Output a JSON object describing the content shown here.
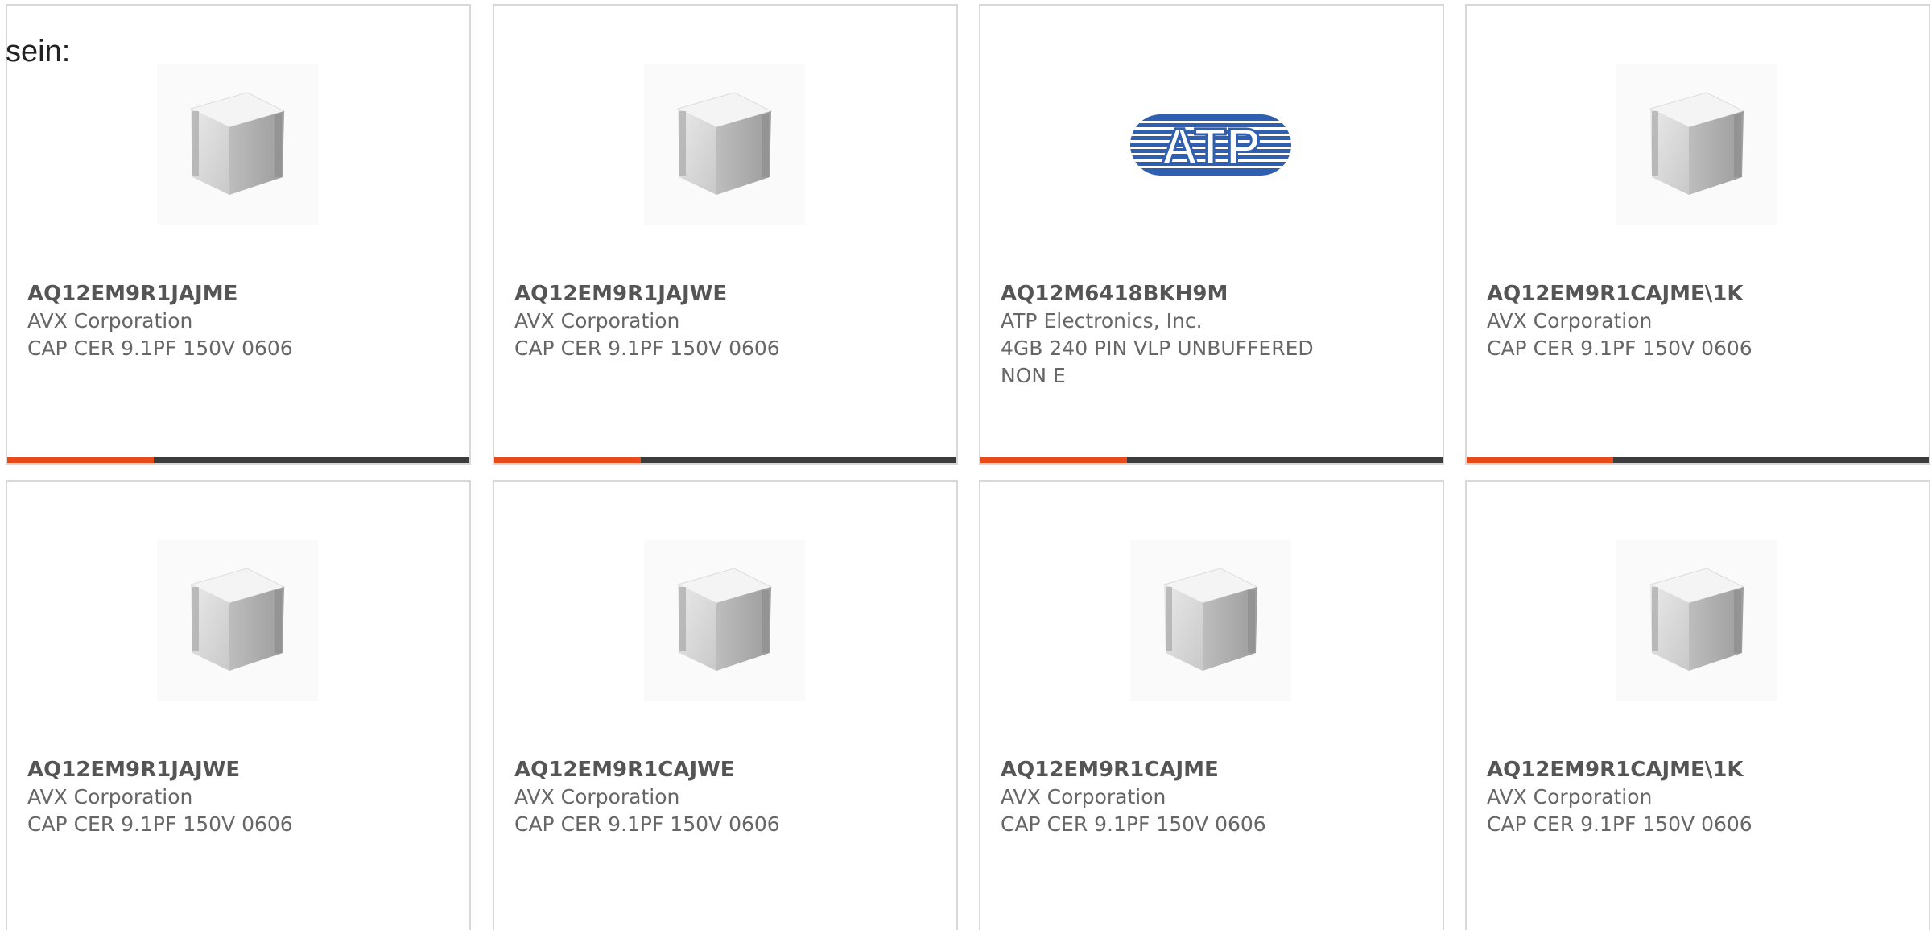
{
  "header": {
    "label": "sein:"
  },
  "colors": {
    "accent": "#e84a1a",
    "bar": "#3c3c3c",
    "border": "#d8d8d8",
    "text": "#666666"
  },
  "products": [
    {
      "part": "AQ12EM9R1JAJME",
      "manufacturer": "AVX Corporation",
      "description": "CAP CER 9.1PF 150V 0606",
      "image": "ceramic-capacitor-icon"
    },
    {
      "part": "AQ12EM9R1JAJWE",
      "manufacturer": "AVX Corporation",
      "description": "CAP CER 9.1PF 150V 0606",
      "image": "ceramic-capacitor-icon"
    },
    {
      "part": "AQ12M6418BKH9M",
      "manufacturer": "ATP Electronics, Inc.",
      "description": "4GB 240 PIN VLP UNBUFFERED NON E",
      "image": "atp-logo",
      "logo_text": "ATP"
    },
    {
      "part": "AQ12EM9R1CAJME\\1K",
      "manufacturer": "AVX Corporation",
      "description": "CAP CER 9.1PF 150V 0606",
      "image": "ceramic-capacitor-icon"
    },
    {
      "part": "AQ12EM9R1JAJWE",
      "manufacturer": "AVX Corporation",
      "description": "CAP CER 9.1PF 150V 0606",
      "image": "ceramic-capacitor-icon"
    },
    {
      "part": "AQ12EM9R1CAJWE",
      "manufacturer": "AVX Corporation",
      "description": "CAP CER 9.1PF 150V 0606",
      "image": "ceramic-capacitor-icon"
    },
    {
      "part": "AQ12EM9R1CAJME",
      "manufacturer": "AVX Corporation",
      "description": "CAP CER 9.1PF 150V 0606",
      "image": "ceramic-capacitor-icon"
    },
    {
      "part": "AQ12EM9R1CAJME\\1K",
      "manufacturer": "AVX Corporation",
      "description": "CAP CER 9.1PF 150V 0606",
      "image": "ceramic-capacitor-icon"
    }
  ]
}
